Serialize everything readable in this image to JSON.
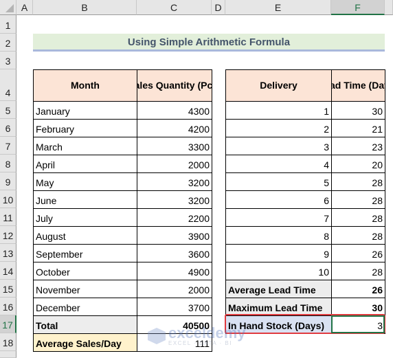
{
  "columns": [
    "A",
    "B",
    "C",
    "D",
    "E",
    "F"
  ],
  "selected_column": "F",
  "rows": [
    "1",
    "2",
    "3",
    "4",
    "5",
    "6",
    "7",
    "8",
    "9",
    "10",
    "11",
    "12",
    "13",
    "14",
    "15",
    "16",
    "17",
    "18"
  ],
  "selected_row": "17",
  "title": "Using Simple Arithmetic Formula",
  "sales_table": {
    "headers": [
      "Month",
      "Sales Quantity (Pcs)"
    ],
    "rows": [
      {
        "month": "January",
        "qty": "4300"
      },
      {
        "month": "February",
        "qty": "4200"
      },
      {
        "month": "March",
        "qty": "3300"
      },
      {
        "month": "April",
        "qty": "2000"
      },
      {
        "month": "May",
        "qty": "3200"
      },
      {
        "month": "June",
        "qty": "3200"
      },
      {
        "month": "July",
        "qty": "2200"
      },
      {
        "month": "August",
        "qty": "3900"
      },
      {
        "month": "September",
        "qty": "3600"
      },
      {
        "month": "October",
        "qty": "4900"
      },
      {
        "month": "November",
        "qty": "2000"
      },
      {
        "month": "December",
        "qty": "3700"
      }
    ],
    "total_label": "Total",
    "total_value": "40500",
    "avg_label": "Average Sales/Day",
    "avg_value": "111"
  },
  "lead_table": {
    "headers": [
      "Delivery",
      "Lead Time (Days)"
    ],
    "rows": [
      {
        "delivery": "1",
        "lead": "30"
      },
      {
        "delivery": "2",
        "lead": "21"
      },
      {
        "delivery": "3",
        "lead": "23"
      },
      {
        "delivery": "4",
        "lead": "20"
      },
      {
        "delivery": "5",
        "lead": "28"
      },
      {
        "delivery": "6",
        "lead": "28"
      },
      {
        "delivery": "7",
        "lead": "28"
      },
      {
        "delivery": "8",
        "lead": "28"
      },
      {
        "delivery": "9",
        "lead": "26"
      },
      {
        "delivery": "10",
        "lead": "28"
      }
    ],
    "avg_label": "Average Lead Time",
    "avg_value": "26",
    "max_label": "Maximum Lead Time",
    "max_value": "30",
    "stock_label": "In Hand Stock (Days)",
    "stock_value": "3"
  },
  "watermark": {
    "main": "exceldemy",
    "sub": "EXCEL · DATA · BI"
  },
  "colors": {
    "header_fill": "#fce4d6",
    "title_fill": "#e2efda",
    "total_fill": "#ededed",
    "avg_fill": "#fff2cc",
    "stock_fill": "#d9e1f2",
    "highlight": "#e0393e",
    "excel_green": "#217346"
  }
}
